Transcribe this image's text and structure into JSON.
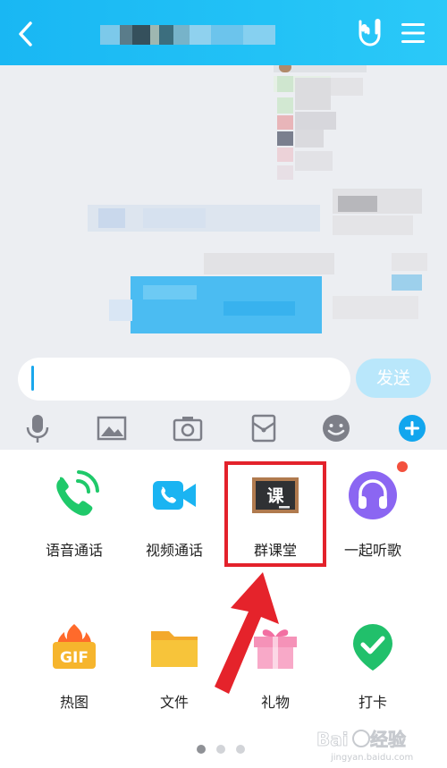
{
  "input": {
    "placeholder": "",
    "send_label": "发送"
  },
  "features": [
    {
      "label": "语音通话",
      "icon": "phone-call-icon",
      "color": "#1fc96a"
    },
    {
      "label": "视频通话",
      "icon": "video-call-icon",
      "color": "#1ab4f2"
    },
    {
      "label": "群课堂",
      "icon": "classroom-blackboard-icon",
      "board_text": "课"
    },
    {
      "label": "一起听歌",
      "icon": "headphones-icon",
      "color": "#8b66f2"
    },
    {
      "label": "热图",
      "icon": "gif-hot-icon",
      "badge_text": "GIF"
    },
    {
      "label": "文件",
      "icon": "folder-icon",
      "color": "#f7c43a"
    },
    {
      "label": "礼物",
      "icon": "gift-icon",
      "color": "#f592b8"
    },
    {
      "label": "打卡",
      "icon": "checkin-pin-icon",
      "color": "#21c06b"
    }
  ],
  "pager": {
    "pages": 3,
    "active": 1
  },
  "colors": {
    "header": "#1bb8f4",
    "send_disabled": "#b9e7fb",
    "highlight": "#e3222b"
  }
}
